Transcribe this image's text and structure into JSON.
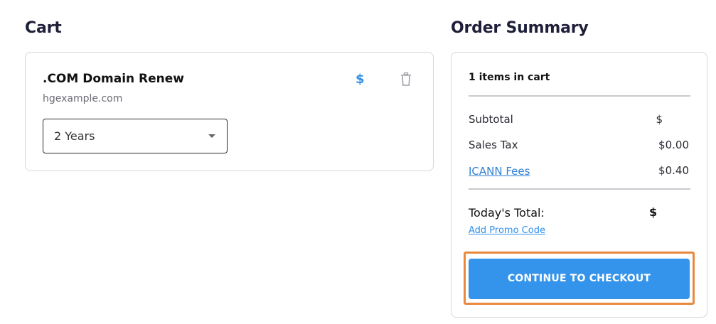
{
  "cart": {
    "heading": "Cart",
    "item": {
      "title": ".COM Domain Renew",
      "domain": "hgexample.com",
      "price_symbol": "$",
      "term_select": {
        "value": "2 Years"
      }
    }
  },
  "summary": {
    "heading": "Order Summary",
    "items_count": "1 items in cart",
    "rows": [
      {
        "label": "Subtotal",
        "value": "$"
      },
      {
        "label": "Sales Tax",
        "value": "$0.00"
      },
      {
        "label": "ICANN Fees",
        "value": "$0.40"
      }
    ],
    "total_label": "Today's Total:",
    "total_value": "$",
    "promo_link": "Add Promo Code",
    "checkout_button": "CONTINUE TO CHECKOUT"
  },
  "icons": {
    "trash": "trash-icon",
    "dropdown": "chevron-down-icon",
    "price": "dollar-icon"
  },
  "colors": {
    "accent": "#3493ea",
    "link": "#2f7fd1",
    "highlight": "#e8893d"
  }
}
